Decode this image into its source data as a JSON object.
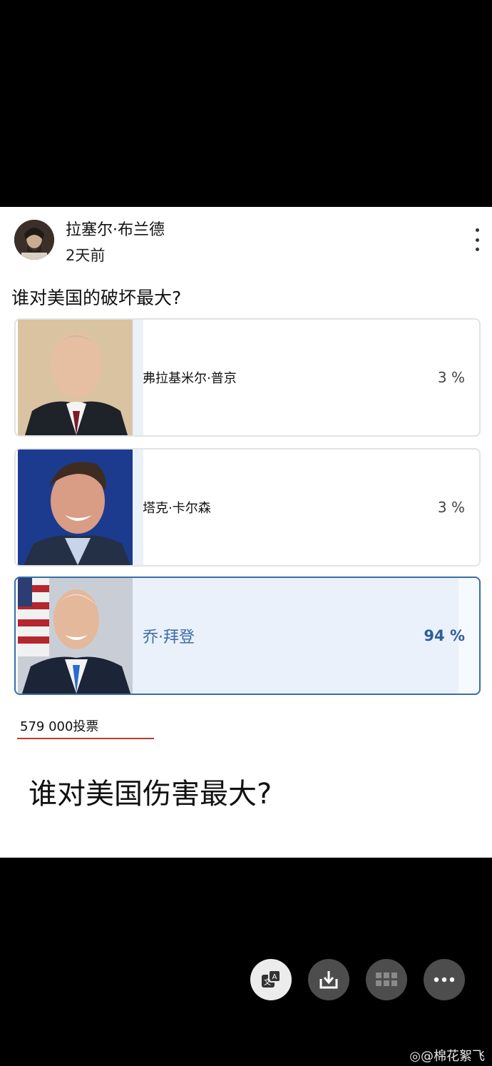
{
  "post": {
    "author": "拉塞尔·布兰德",
    "time": "2天前",
    "question": "谁对美国的破坏最大?",
    "options": [
      {
        "name": "弗拉基米尔·普京",
        "percent": "3 %",
        "fill": 0.03,
        "selected": false
      },
      {
        "name": "塔克·卡尔森",
        "percent": "3 %",
        "fill": 0.03,
        "selected": false
      },
      {
        "name": "乔·拜登",
        "percent": "94 %",
        "fill": 0.94,
        "selected": true
      }
    ],
    "votes": "579 000投票",
    "caption": "谁对美国伤害最大?"
  },
  "toolbar": {
    "translate_icon": "translate-icon",
    "download_icon": "download-icon",
    "grid_icon": "grid-icon",
    "more_icon": "more-icon"
  },
  "watermark": "@棉花絮飞",
  "colors": {
    "accent": "#3a6ea5",
    "votes_underline": "#c0392b"
  }
}
